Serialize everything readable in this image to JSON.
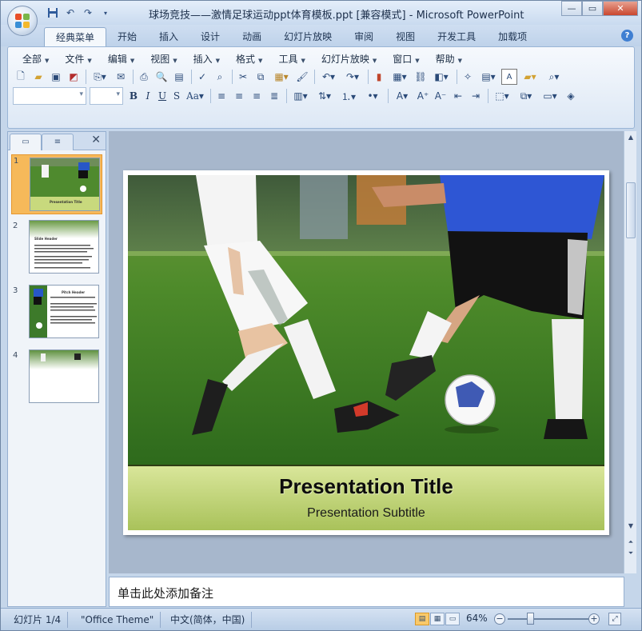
{
  "window": {
    "title": "球场竞技——激情足球运动ppt体育模板.ppt [兼容模式] - Microsoft PowerPoint"
  },
  "tabs": [
    "经典菜单",
    "开始",
    "插入",
    "设计",
    "动画",
    "幻灯片放映",
    "审阅",
    "视图",
    "开发工具",
    "加载项"
  ],
  "menu": [
    "全部",
    "文件",
    "编辑",
    "视图",
    "插入",
    "格式",
    "工具",
    "幻灯片放映",
    "窗口",
    "帮助"
  ],
  "slides_panel": {
    "thumbnails": [
      {
        "number": "1",
        "title": "Presentation Title"
      },
      {
        "number": "2",
        "title": "Slide Header"
      },
      {
        "number": "3",
        "title": "Pitch Header"
      },
      {
        "number": "4",
        "title": ""
      }
    ]
  },
  "slide": {
    "title": "Presentation Title",
    "subtitle": "Presentation Subtitle"
  },
  "notes": {
    "placeholder": "单击此处添加备注"
  },
  "status": {
    "slide_indicator": "幻灯片 1/4",
    "theme": "\"Office Theme\"",
    "language": "中文(简体，中国)",
    "zoom": "64%"
  },
  "colors": {
    "accent_selected": "#f6b95a",
    "title_band_top": "#d9e69a",
    "title_band_bottom": "#a9c25a",
    "ribbon_bg": "#dde8f5",
    "stage_bg": "#a7b7cc"
  }
}
